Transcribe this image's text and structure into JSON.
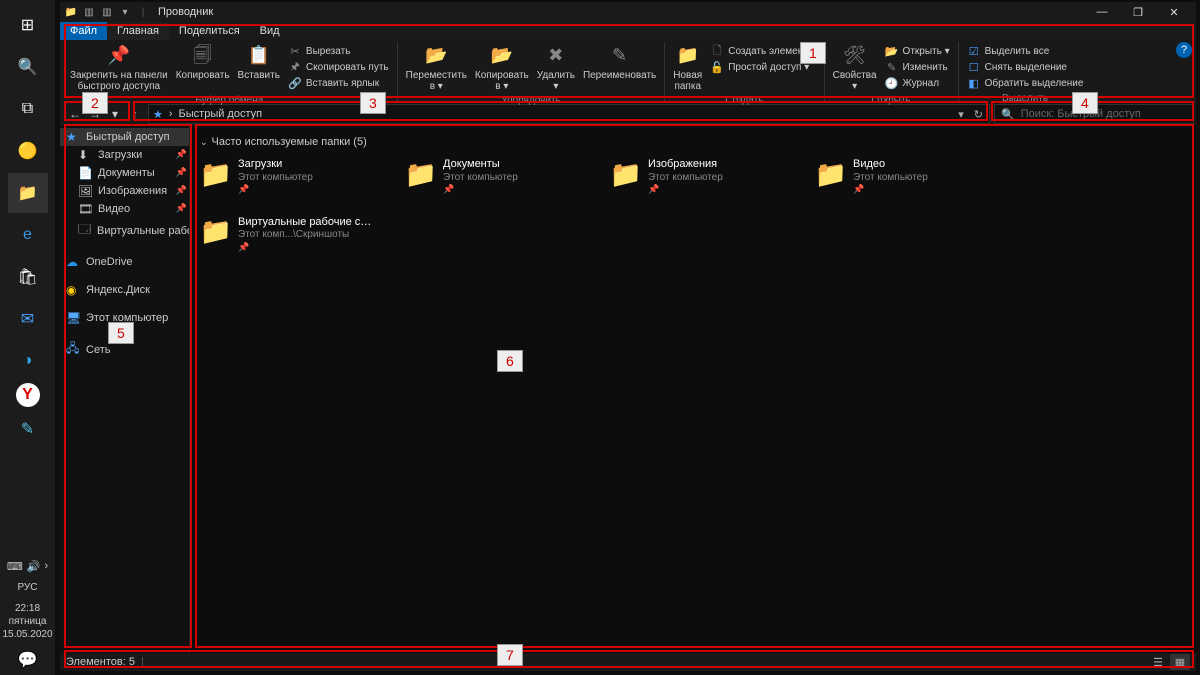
{
  "window": {
    "title": "Проводник",
    "min": "—",
    "max": "❐",
    "close": "✕"
  },
  "ribbon_tabs": {
    "file": "Файл",
    "home": "Главная",
    "share": "Поделиться",
    "view": "Вид"
  },
  "ribbon": {
    "pin": "Закрепить на панели\nбыстрого доступа",
    "copy": "Копировать",
    "paste": "Вставить",
    "cut": "Вырезать",
    "copy_path": "Скопировать путь",
    "paste_shortcut": "Вставить ярлык",
    "clipboard_group": "Буфер обмена",
    "move_to": "Переместить\nв ▾",
    "copy_to": "Копировать\nв ▾",
    "delete": "Удалить\n▾",
    "rename": "Переименовать",
    "organize_group": "Упорядочить",
    "new_folder": "Новая\nпапка",
    "new_item": "Создать элемент ▾",
    "easy_access": "Простой доступ ▾",
    "create_group": "Создать",
    "properties": "Свойства\n▾",
    "open": "Открыть ▾",
    "edit": "Изменить",
    "history": "Журнал",
    "open_group": "Открыть",
    "select_all": "Выделить все",
    "select_none": "Снять выделение",
    "invert_selection": "Обратить выделение",
    "select_group": "Выделить"
  },
  "nav": {
    "back": "←",
    "forward": "→",
    "recent": "▾",
    "up": "↑",
    "refresh": "↻",
    "dropdown": "▾"
  },
  "breadcrumb": {
    "root_icon": "★",
    "root": "Быстрый доступ",
    "sep": "›"
  },
  "search": {
    "placeholder": "Поиск: Быстрый доступ",
    "icon": "🔍"
  },
  "sidebar": {
    "quick_access": "Быстрый доступ",
    "items": [
      {
        "icon": "⬇",
        "label": "Загрузки"
      },
      {
        "icon": "📄",
        "label": "Документы"
      },
      {
        "icon": "🖼",
        "label": "Изображения"
      },
      {
        "icon": "🎞",
        "label": "Видео"
      },
      {
        "icon": "🗔",
        "label": "Виртуальные рабочие ст…"
      }
    ],
    "onedrive": "OneDrive",
    "yadisk": "Яндекс.Диск",
    "this_pc": "Этот компьютер",
    "network": "Сеть"
  },
  "content": {
    "group_header": "Часто используемые папки (5)",
    "folders": [
      {
        "name": "Загрузки",
        "loc": "Этот компьютер",
        "icon": "📁"
      },
      {
        "name": "Документы",
        "loc": "Этот компьютер",
        "icon": "📁"
      },
      {
        "name": "Изображения",
        "loc": "Этот компьютер",
        "icon": "📁"
      },
      {
        "name": "Видео",
        "loc": "Этот компьютер",
        "icon": "📁"
      },
      {
        "name": "Виртуальные рабочие с…",
        "loc": "Этот комп...\\Скриншоты",
        "icon": "📁"
      }
    ]
  },
  "status": {
    "items": "Элементов: 5"
  },
  "taskbar": {
    "tray_lang": "РУС",
    "time": "22:18",
    "day": "пятница",
    "date": "15.05.2020"
  },
  "annotations": {
    "l1": "1",
    "l2": "2",
    "l3": "3",
    "l4": "4",
    "l5": "5",
    "l6": "6",
    "l7": "7"
  }
}
